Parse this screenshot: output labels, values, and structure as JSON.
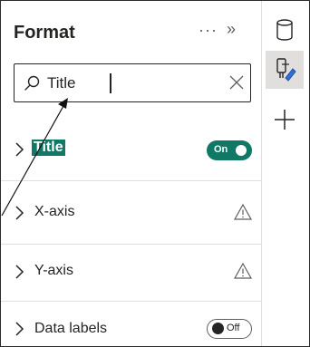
{
  "pane": {
    "title": "Format",
    "more_icon": "ellipsis-icon",
    "collapse_icon": "double-chevron-right-icon"
  },
  "search": {
    "value": "Title",
    "icon": "search-icon",
    "clear_icon": "close-icon"
  },
  "cards": [
    {
      "label": "Title",
      "toggle": "On",
      "highlighted": true
    },
    {
      "label": "X-axis",
      "status_icon": "warning-icon"
    },
    {
      "label": "Y-axis",
      "status_icon": "warning-icon"
    },
    {
      "label": "Data labels",
      "toggle": "Off"
    }
  ],
  "rail": {
    "items": [
      {
        "icon": "data-cylinder-icon"
      },
      {
        "icon": "format-paintbrush-icon",
        "active": true
      },
      {
        "icon": "plus-icon"
      }
    ]
  },
  "colors": {
    "accent": "#117865",
    "text": "#252423",
    "muted": "#605e5c"
  }
}
